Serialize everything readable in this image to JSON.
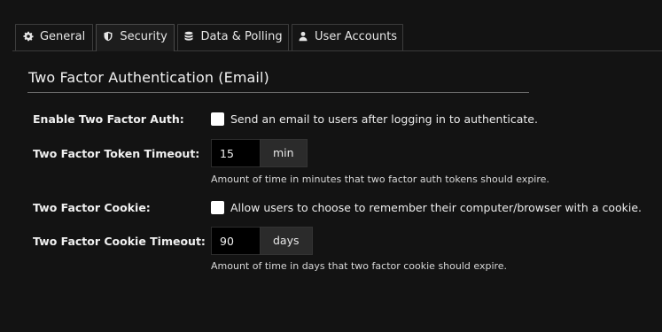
{
  "tabs": [
    {
      "label": "General",
      "icon": "gear-icon",
      "active": false
    },
    {
      "label": "Security",
      "icon": "shield-icon",
      "active": true
    },
    {
      "label": "Data & Polling",
      "icon": "database-icon",
      "active": false
    },
    {
      "label": "User Accounts",
      "icon": "user-icon",
      "active": false
    }
  ],
  "section": {
    "title": "Two Factor Authentication (Email)"
  },
  "fields": {
    "enable_2fa": {
      "label": "Enable Two Factor Auth:",
      "checkbox_text": "Send an email to users after logging in to authenticate.",
      "checked": false
    },
    "token_timeout": {
      "label": "Two Factor Token Timeout:",
      "value": "15",
      "unit": "min",
      "help": "Amount of time in minutes that two factor auth tokens should expire."
    },
    "cookie": {
      "label": "Two Factor Cookie:",
      "checkbox_text": "Allow users to choose to remember their computer/browser with a cookie.",
      "checked": false
    },
    "cookie_timeout": {
      "label": "Two Factor Cookie Timeout:",
      "value": "90",
      "unit": "days",
      "help": "Amount of time in days that two factor cookie should expire."
    }
  },
  "colors": {
    "background": "#131313",
    "tab_active_bg": "#1d1d1d",
    "addon_bg": "#2b2b2b",
    "input_bg": "#000000"
  }
}
